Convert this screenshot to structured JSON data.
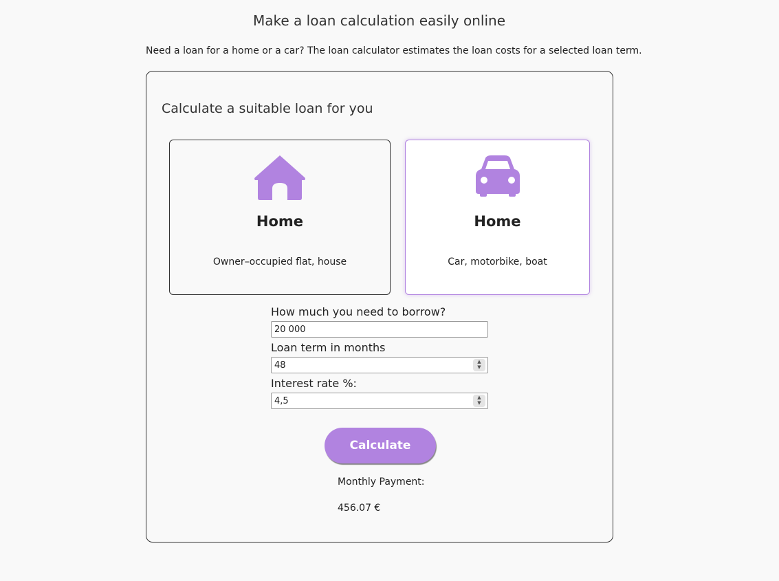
{
  "header": {
    "title": "Make a loan calculation easily online",
    "intro": "Need a loan for a home or a car? The loan calculator estimates the loan costs for a selected loan term."
  },
  "card": {
    "heading": "Calculate a suitable loan for you",
    "options": [
      {
        "icon": "house-icon",
        "title": "Home",
        "description": "Owner–occupied flat, house",
        "selected": false
      },
      {
        "icon": "car-icon",
        "title": "Home",
        "description": "Car, motorbike, boat",
        "selected": true
      }
    ]
  },
  "form": {
    "amount_label": "How much you need to borrow?",
    "amount_value": "20 000",
    "term_label": "Loan term in months",
    "term_value": "48",
    "rate_label": "Interest rate %:",
    "rate_value": "4,5",
    "calculate_label": "Calculate"
  },
  "result": {
    "label": "Monthly Payment:",
    "value": "456.07 €"
  },
  "colors": {
    "accent": "#b183e0",
    "background": "#f9f9f9",
    "border": "#333333"
  }
}
